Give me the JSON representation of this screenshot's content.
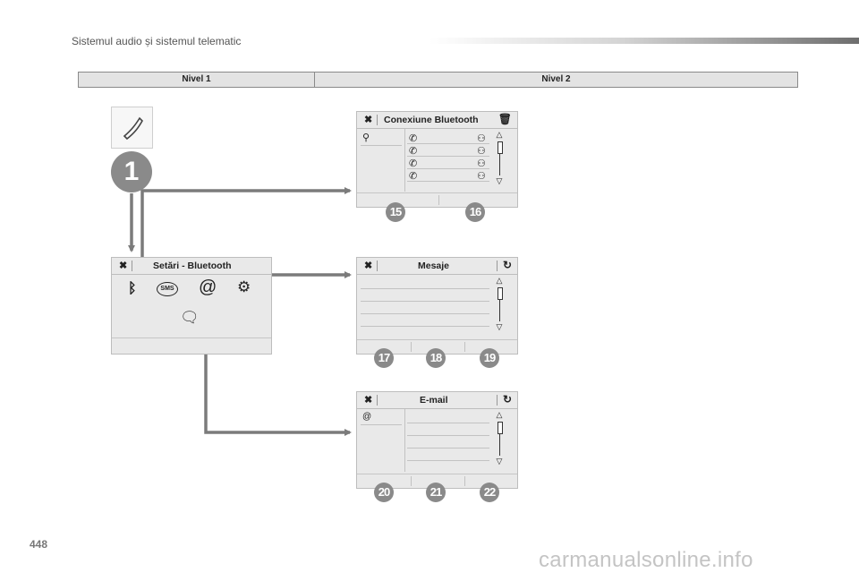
{
  "header": {
    "section_title": "Sistemul audio și sistemul telematic"
  },
  "levels": {
    "level1": "Nivel 1",
    "level2": "Nivel 2"
  },
  "menu_entry": {
    "number": "1"
  },
  "panels": {
    "bluetooth_connection": {
      "title": "Conexiune Bluetooth",
      "markers": [
        "15",
        "16"
      ]
    },
    "bluetooth_settings": {
      "title": "Setări - Bluetooth"
    },
    "messages": {
      "title": "Mesaje",
      "markers": [
        "17",
        "18",
        "19"
      ]
    },
    "email": {
      "title": "E-mail",
      "email_symbol": "@",
      "markers": [
        "20",
        "21",
        "22"
      ]
    }
  },
  "footer": {
    "page_number": "448",
    "watermark": "carmanualsonline.info"
  },
  "icons": [
    "phone-icon",
    "close-icon",
    "trash-icon",
    "refresh-icon",
    "search-icon",
    "bluetooth-icon",
    "sms-icon",
    "at-icon",
    "settings-icon",
    "message-list-icon"
  ]
}
